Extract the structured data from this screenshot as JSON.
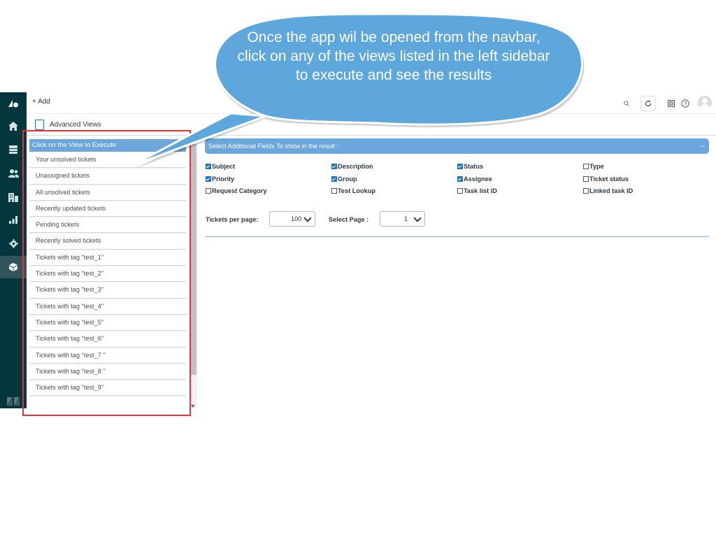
{
  "callout": {
    "text": "Once the app wil be opened from the navbar, click on any of the views listed in the left sidebar to execute and see the results"
  },
  "topbar": {
    "add_label": "+ Add",
    "icons": [
      "search-icon",
      "refresh-icon",
      "apps-icon",
      "help-icon",
      "avatar"
    ]
  },
  "nav": {
    "icons": [
      "zendesk-logo-icon",
      "home-icon",
      "views-icon",
      "customers-icon",
      "organizations-icon",
      "reporting-icon",
      "admin-icon",
      "apps-box-icon",
      "zendesk-footer-icon"
    ]
  },
  "app": {
    "title": "Advanced Views"
  },
  "sidebar": {
    "header": "Click on the View to Execute",
    "items": [
      "Your unsolved tickets",
      "Unassigned tickets",
      "All unsolved tickets",
      "Recently updated tickets",
      "Pending tickets",
      "Recently solved tickets",
      "Tickets with tag \"test_1\"",
      "Tickets with tag \"test_2\"",
      "Tickets with tag \"test_3\"",
      "Tickets with tag \"test_4\"",
      "Tickets with tag \"test_5\"",
      "Tickets with tag \"test_6\"",
      "Tickets with tag \"test_7 \"",
      "Tickets with tag \"test_8 \"",
      "Tickets with tag \"test_9\""
    ]
  },
  "fields": {
    "title": "Select Additional Fields To show in the result :",
    "collapse": "–",
    "items": [
      {
        "label": "Subject",
        "checked": true
      },
      {
        "label": "Description",
        "checked": true
      },
      {
        "label": "Status",
        "checked": true
      },
      {
        "label": "Type",
        "checked": false
      },
      {
        "label": "Priority",
        "checked": true
      },
      {
        "label": "Group",
        "checked": true
      },
      {
        "label": "Assignee",
        "checked": true
      },
      {
        "label": "Ticket status",
        "checked": false
      },
      {
        "label": "Request Category",
        "checked": false
      },
      {
        "label": "Test Lookup",
        "checked": false
      },
      {
        "label": "Task list ID",
        "checked": false
      },
      {
        "label": "Linked task ID",
        "checked": false
      }
    ]
  },
  "pagination": {
    "per_page_label": "Tickets per page:",
    "per_page_value": "100",
    "page_label": "Select Page :",
    "page_value": "1"
  },
  "colors": {
    "nav_bg": "#03363d",
    "accent": "#6ba7dc",
    "highlight_box": "#e4313b"
  }
}
